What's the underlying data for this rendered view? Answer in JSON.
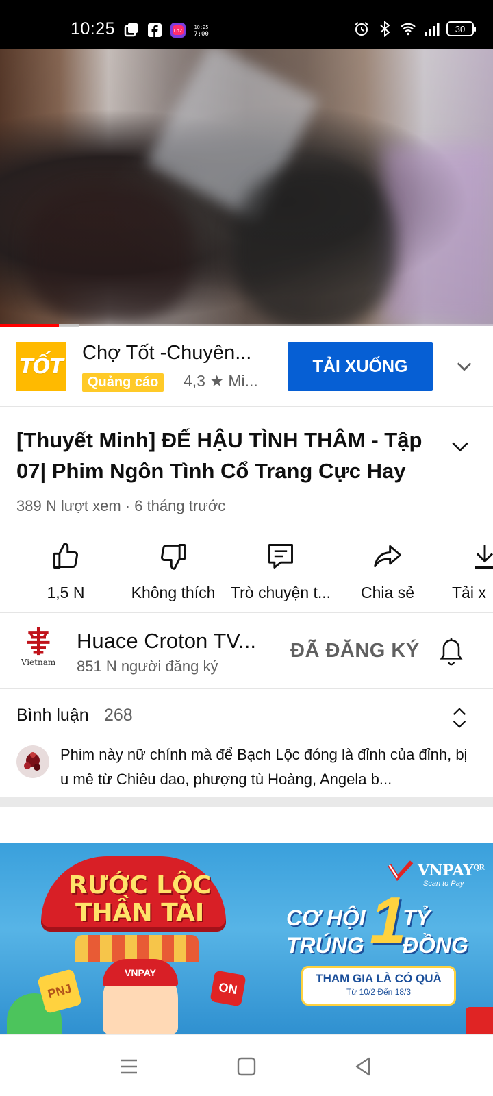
{
  "status_bar": {
    "time": "10:25",
    "battery": "30",
    "left_icons": [
      "notification-icon",
      "facebook-icon",
      "app-icon",
      "clock-widget-icon"
    ],
    "right_icons": [
      "alarm-icon",
      "bluetooth-icon",
      "wifi-icon",
      "signal-icon",
      "battery-icon"
    ]
  },
  "video": {
    "progress_played": 0.12,
    "progress_buffered": 0.16
  },
  "ad": {
    "logo_text": "TỐT",
    "title": "Chợ Tốt -Chuyên...",
    "badge": "Quảng cáo",
    "rating": "4,3 ★ Mi...",
    "button": "TẢI XUỐNG",
    "colors": {
      "logo": "#ffba00",
      "badge": "#ffca28",
      "button": "#065fd4"
    }
  },
  "video_info": {
    "title": "[Thuyết Minh] ĐẾ HẬU TÌNH THÂM - Tập 07| Phim Ngôn Tình Cổ Trang Cực Hay ...",
    "meta": "389 N lượt xem · 6 tháng trước"
  },
  "actions": [
    {
      "label": "1,5 N",
      "icon": "like-icon"
    },
    {
      "label": "Không thích",
      "icon": "dislike-icon"
    },
    {
      "label": "Trò chuyện t...",
      "icon": "chat-icon"
    },
    {
      "label": "Chia sẻ",
      "icon": "share-icon"
    },
    {
      "label": "Tải x",
      "icon": "download-icon"
    }
  ],
  "channel": {
    "avatar_text": "Vietnam",
    "name": "Huace Croton TV...",
    "subscribers": "851 N người đăng ký",
    "subscribed_label": "ĐÃ ĐĂNG KÝ"
  },
  "comments": {
    "header": "Bình luận",
    "count": "268",
    "top_comment": "Phim này nữ chính mà để Bạch Lộc đóng là đỉnh của đỉnh, bị u mê từ Chiêu dao, phượng tù Hoàng,  Angela b..."
  },
  "banner": {
    "title_line1": "RƯỚC LỘC",
    "title_line2": "THẦN TÀI",
    "brand": "VNPAY",
    "brand_suffix": "QR",
    "brand_tagline": "Scan to Pay",
    "cap_text": "VNPAY",
    "coin1": "PNJ",
    "coin2": "ON",
    "line1": "CƠ HỘI",
    "big_number": "1",
    "line2": "TRÚNG",
    "line3": "TỶ",
    "line4": "ĐỒNG",
    "pill_main": "THAM GIA LÀ CÓ QUÀ",
    "pill_sub": "Từ 10/2 Đến 18/3"
  },
  "navbar": {
    "buttons": [
      "menu-icon",
      "home-icon",
      "back-icon"
    ]
  }
}
